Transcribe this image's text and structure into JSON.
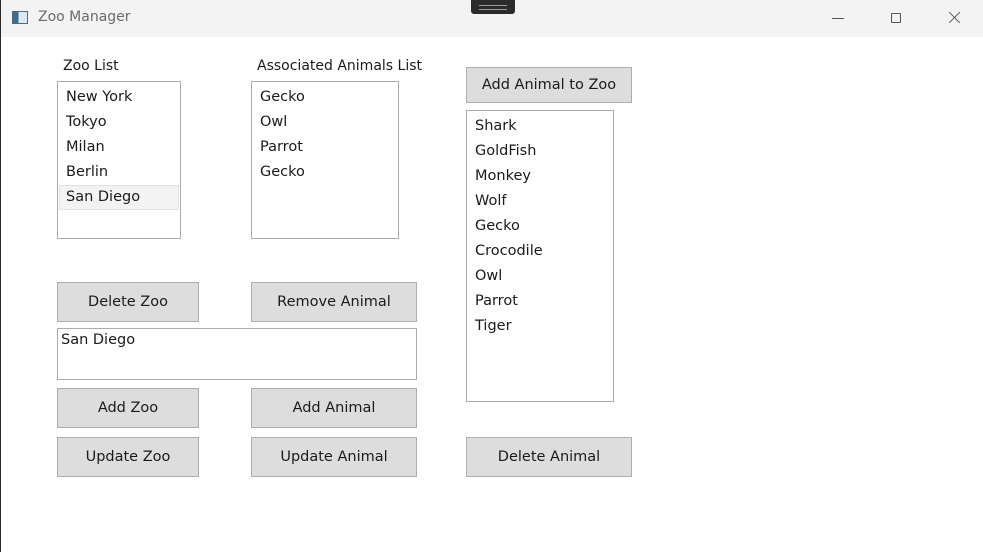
{
  "window": {
    "title": "Zoo Manager",
    "icon": "app-window-icon"
  },
  "zoo_list": {
    "label": "Zoo List",
    "items": [
      "New York",
      "Tokyo",
      "Milan",
      "Berlin",
      "San Diego"
    ],
    "selected": "San Diego"
  },
  "associated_animals": {
    "label": "Associated Animals List",
    "items": [
      "Gecko",
      "Owl",
      "Parrot",
      "Gecko"
    ]
  },
  "all_animals": {
    "items": [
      "Shark",
      "GoldFish",
      "Monkey",
      "Wolf",
      "Gecko",
      "Crocodile",
      "Owl",
      "Parrot",
      "Tiger"
    ]
  },
  "input": {
    "value": "San Diego"
  },
  "buttons": {
    "add_animal_to_zoo": "Add Animal to Zoo",
    "delete_zoo": "Delete Zoo",
    "remove_animal": "Remove Animal",
    "add_zoo": "Add Zoo",
    "add_animal": "Add Animal",
    "update_zoo": "Update Zoo",
    "update_animal": "Update Animal",
    "delete_animal": "Delete Animal"
  }
}
